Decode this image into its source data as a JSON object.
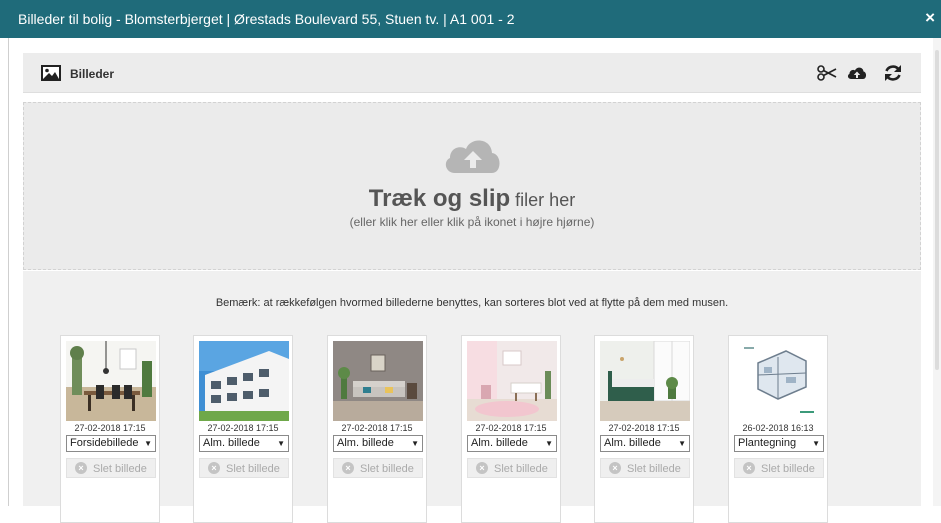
{
  "window": {
    "title": "Billeder til bolig - Blomsterbjerget | Ørestads Boulevard 55, Stuen tv. | A1 001 - 2",
    "close_glyph": "×"
  },
  "panel": {
    "label": "Billeder",
    "icon": "image-icon",
    "tools": [
      "scissors-icon",
      "cloud-upload-icon",
      "refresh-icon"
    ]
  },
  "dropzone": {
    "icon": "cloud-upload-icon",
    "strong_text": "Træk og slip",
    "rest_text": " filer her",
    "hint": "(eller klik her eller klik på ikonet i højre hjørne)"
  },
  "notice": "Bemærk: at rækkefølgen hvormed billederne benyttes, kan sorteres blot ved at flytte på dem med musen.",
  "images": [
    {
      "date": "27-02-2018 17:15",
      "type": "Forsidebillede",
      "delete_label": "Slet billede"
    },
    {
      "date": "27-02-2018 17:15",
      "type": "Alm. billede",
      "delete_label": "Slet billede"
    },
    {
      "date": "27-02-2018 17:15",
      "type": "Alm. billede",
      "delete_label": "Slet billede"
    },
    {
      "date": "27-02-2018 17:15",
      "type": "Alm. billede",
      "delete_label": "Slet billede"
    },
    {
      "date": "27-02-2018 17:15",
      "type": "Alm. billede",
      "delete_label": "Slet billede"
    },
    {
      "date": "26-02-2018 16:13",
      "type": "Plantegning",
      "delete_label": "Slet billede"
    }
  ],
  "colors": {
    "titlebar": "#1f6b7a",
    "dropzone_bg": "#ebebeb",
    "icon_dark": "#222222",
    "cloud_gray": "#b5b5b5"
  }
}
